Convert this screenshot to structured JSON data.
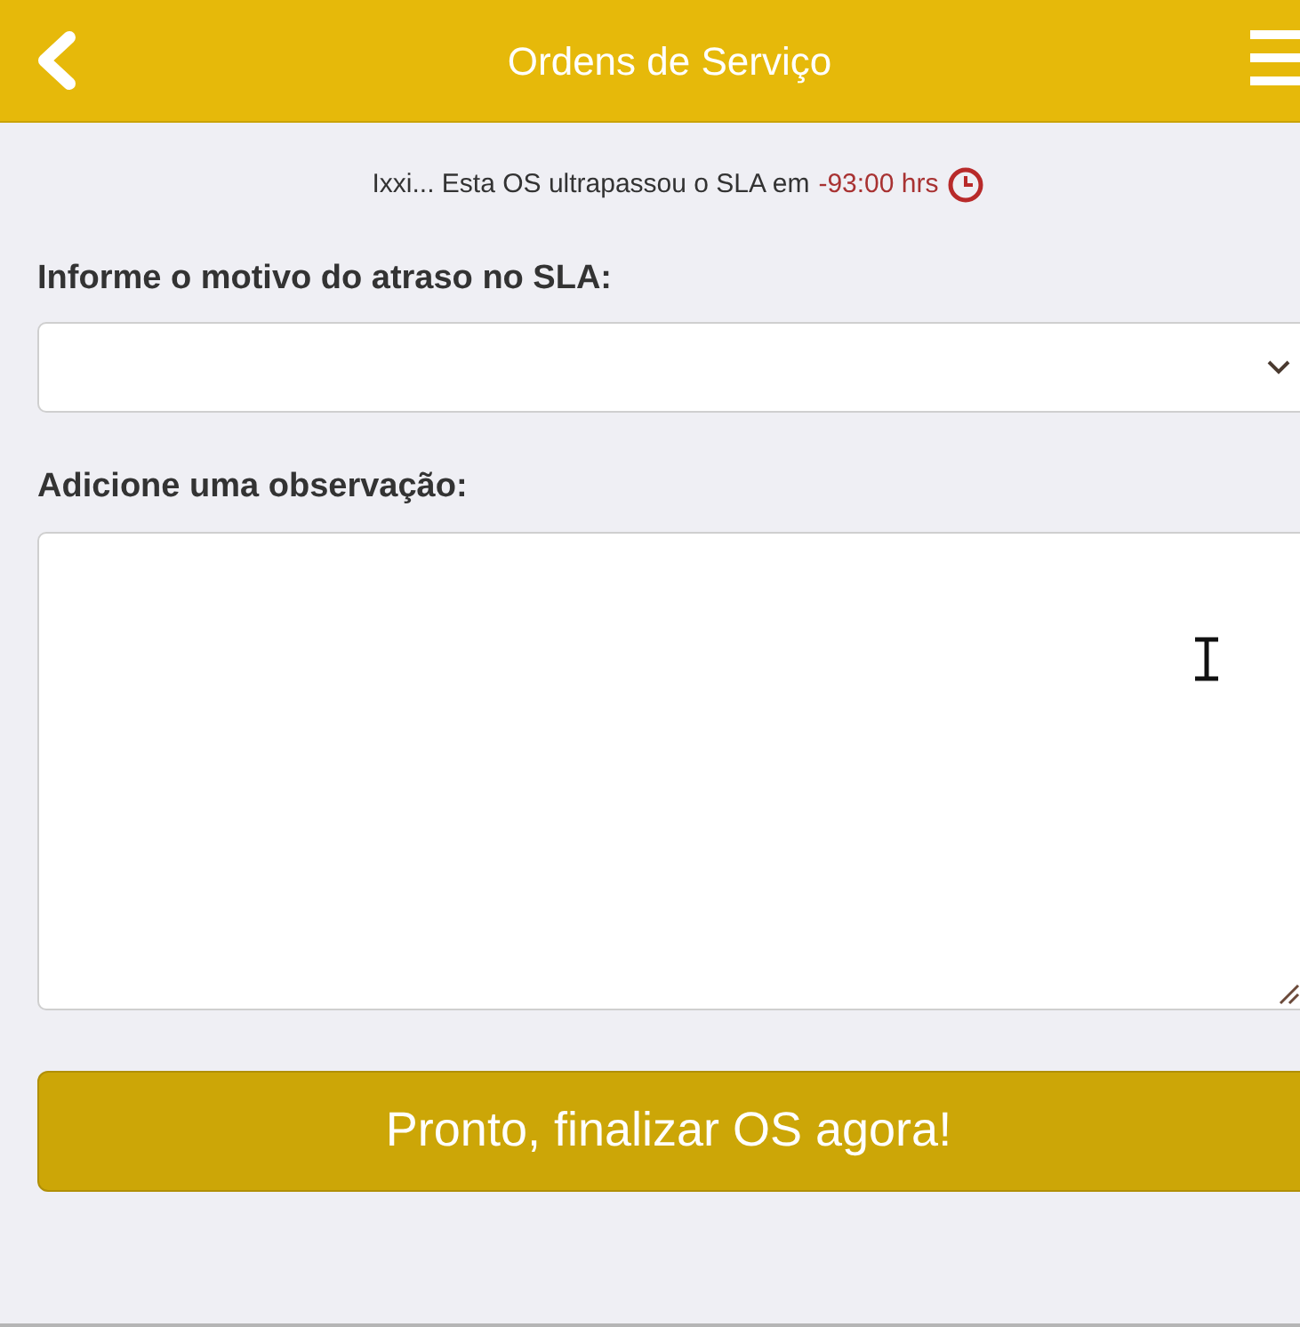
{
  "header": {
    "title": "Ordens de Serviço"
  },
  "notice": {
    "message": "Ixxi... Esta OS ultrapassou o SLA em",
    "overdue": "-93:00 hrs"
  },
  "reason": {
    "label": "Informe o motivo do atraso no SLA:"
  },
  "observation": {
    "label": "Adicione uma observação:"
  },
  "submit": {
    "label": "Pronto, finalizar OS agora!"
  }
}
